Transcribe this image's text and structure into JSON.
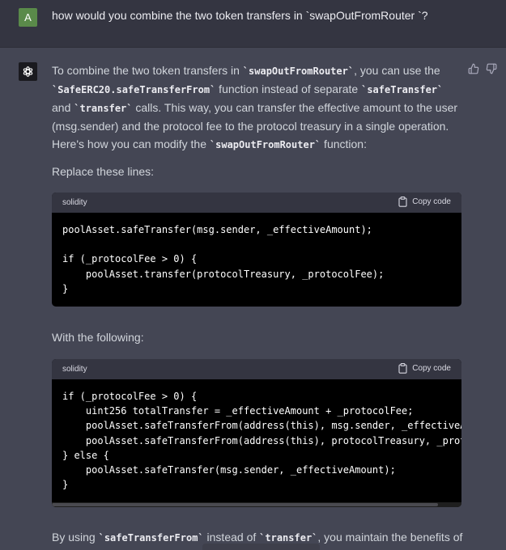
{
  "user": {
    "avatar_initial": "A",
    "message": "how would you combine the two token transfers in `swapOutFromRouter `?"
  },
  "assistant": {
    "avatar_icon": "openai-logo-icon",
    "feedback": [
      "thumbs-up-icon",
      "thumbs-down-icon"
    ],
    "intro": {
      "t1": "To combine the two token transfers in ",
      "c1": "`swapOutFromRouter`",
      "t2": ", you can use the ",
      "c2": "`SafeERC20.safeTransferFrom`",
      "t3": " function instead of separate ",
      "c3": "`safeTransfer`",
      "t4": " and ",
      "c4": "`transfer`",
      "t5": " calls. This way, you can transfer the effective amount to the user (msg.sender) and the protocol fee to the protocol treasury in a single operation. Here's how you can modify the ",
      "c5": "`swapOutFromRouter`",
      "t6": " function:"
    },
    "replace_label": "Replace these lines:",
    "with_label": "With the following:",
    "closing": {
      "t1": "By using ",
      "c1": "`safeTransferFrom`",
      "t2": " instead of ",
      "c2": "`transfer`",
      "t3": ", you maintain the benefits of"
    }
  },
  "code_blocks": [
    {
      "language": "solidity",
      "copy_label": "Copy code",
      "code": "poolAsset.safeTransfer(msg.sender, _effectiveAmount);\n\nif (_protocolFee > 0) {\n    poolAsset.transfer(protocolTreasury, _protocolFee);\n}"
    },
    {
      "language": "solidity",
      "copy_label": "Copy code",
      "code": "if (_protocolFee > 0) {\n    uint256 totalTransfer = _effectiveAmount + _protocolFee;\n    poolAsset.safeTransferFrom(address(this), msg.sender, _effectiveAmount);\n    poolAsset.safeTransferFrom(address(this), protocolTreasury, _protocolFee);\n} else {\n    poolAsset.safeTransfer(msg.sender, _effectiveAmount);\n}"
    }
  ],
  "colors": {
    "user_bg": "#343541",
    "assistant_bg": "#444654",
    "code_bg": "#000000",
    "code_header_bg": "#343541",
    "user_avatar_bg": "#5a8a4a"
  }
}
